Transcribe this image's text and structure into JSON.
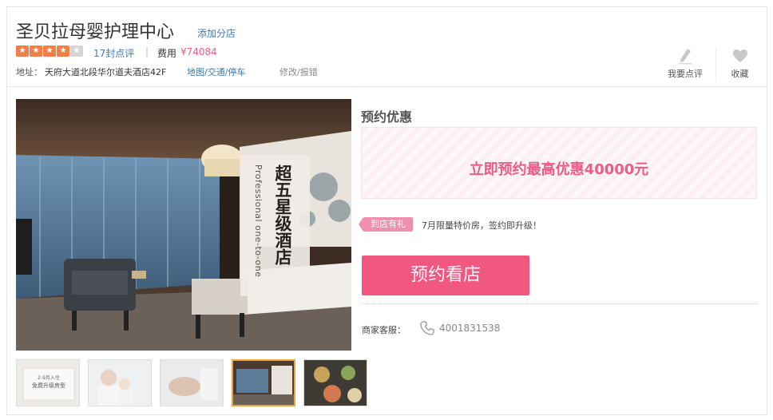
{
  "header": {
    "title": "圣贝拉母婴护理中心",
    "add_branch": "添加分店",
    "rating_stars": 4,
    "rating_max": 5,
    "review_count": "17封点评",
    "separator": "|",
    "cost_label": "费用",
    "cost_value": "¥74084",
    "address_label": "地址：",
    "address": "天府大道北段华尔道夫酒店42F",
    "map_link": "地图/交通/停车",
    "report_link": "修改/报错",
    "write_review": "我要点评",
    "favorite": "收藏"
  },
  "gallery": {
    "banner_cn": "超五星级酒店",
    "banner_en": "Professional one-to-one",
    "thumbnails": [
      {
        "caption_line1": "2-9月入住",
        "caption_line2": "免费升级房型"
      },
      {},
      {},
      {},
      {}
    ],
    "active_thumbnail": 3
  },
  "booking": {
    "promo_title": "预约优惠",
    "promo_text": "立即预约最高优惠40000元",
    "gift_badge": "到店有礼",
    "gift_text": "7月限量特价房，签约即升级！",
    "book_button": "预约看店",
    "cs_label": "商家客服：",
    "phone": "4001831538"
  },
  "colors": {
    "accent": "#f0587f",
    "link": "#3d7ab6",
    "star": "#f47f46",
    "promo_text": "#ea5d88"
  }
}
